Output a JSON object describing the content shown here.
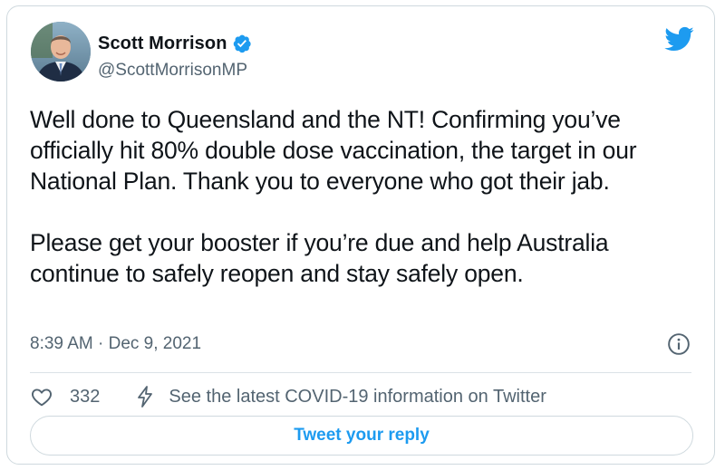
{
  "author": {
    "display_name": "Scott Morrison",
    "handle": "@ScottMorrisonMP",
    "verified": true,
    "avatar_icon": "profile-photo"
  },
  "brand": {
    "icon": "twitter-bird-icon",
    "color": "#1d9bf0"
  },
  "tweet": {
    "paragraphs": [
      "Well done to Queensland and the NT! Confirming you’ve officially hit 80% double dose vaccination, the target in our National Plan. Thank you to everyone who got their jab.",
      "Please get your booster if you’re due and help Australia continue to safely reopen and stay safely open."
    ],
    "timestamp": "8:39 AM · Dec 9, 2021"
  },
  "actions": {
    "like_count": "332",
    "covid_info_label": "See the latest COVID-19 information on Twitter"
  },
  "reply": {
    "button_label": "Tweet your reply"
  },
  "colors": {
    "text_primary": "#0f1419",
    "text_secondary": "#536471",
    "accent": "#1d9bf0",
    "border": "#cfd9de"
  }
}
